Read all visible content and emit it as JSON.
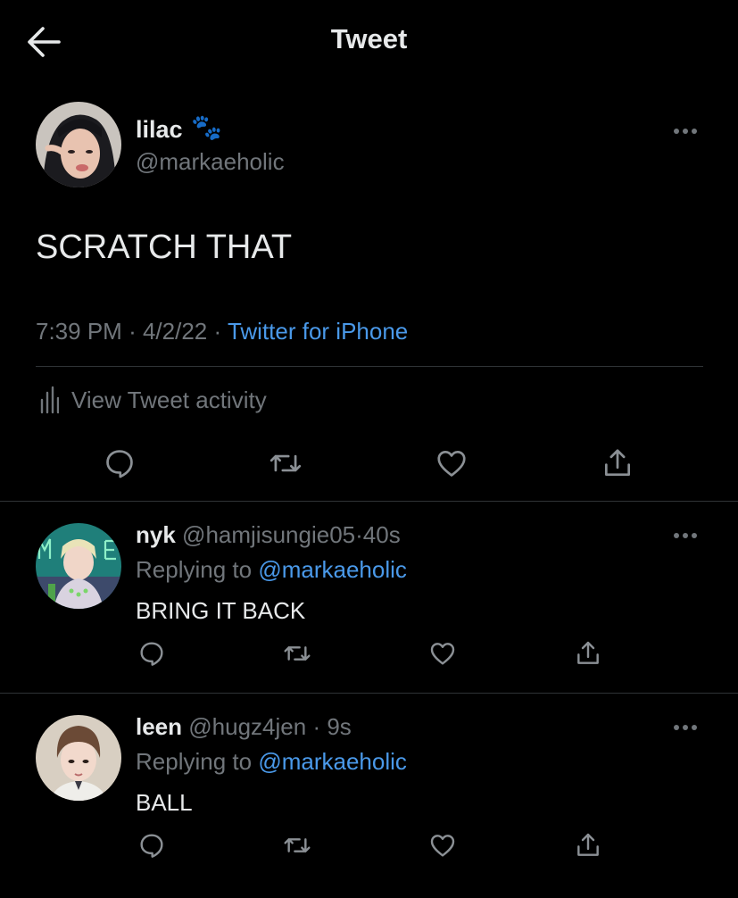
{
  "header": {
    "title": "Tweet"
  },
  "tweet": {
    "display_name": "lilac",
    "name_emoji": "🐾",
    "handle": "@markaeholic",
    "text": "SCRATCH THAT",
    "time": "7:39 PM",
    "sep1": "·",
    "date": "4/2/22",
    "sep2": "·",
    "source": "Twitter for iPhone",
    "activity_label": "View Tweet activity"
  },
  "replies": [
    {
      "display_name": "nyk",
      "handle": "@hamjisungie05",
      "sep": "·",
      "time": "40s",
      "replying_prefix": "Replying to",
      "replying_to": "@markaeholic",
      "text": "BRING IT BACK"
    },
    {
      "display_name": "leen",
      "handle": "@hugz4jen",
      "sep": "·",
      "time": "9s",
      "replying_prefix": "Replying to",
      "replying_to": "@markaeholic",
      "text": "BALL"
    }
  ],
  "colors": {
    "background": "#000000",
    "text": "#e7e9ea",
    "muted": "#71767b",
    "link": "#4a99e9",
    "divider": "#2f3336"
  }
}
